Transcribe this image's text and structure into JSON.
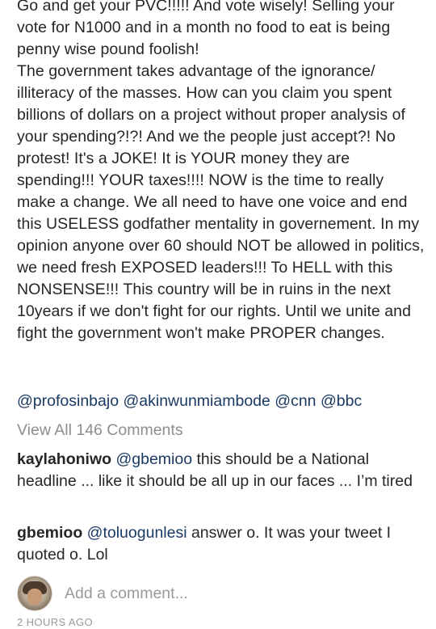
{
  "post": {
    "caption": "Go and get your PVC!!!!! And vote wisely! Selling your vote for N1000 and in a month no food to eat is being penny wise pound foolish!\nThe government takes advantage of the ignorance/ illiteracy of the masses. How can you claim you spent billions of dollars on a project without proper analysis of your spending?!?! And we the people just accept?! No protest! It's a JOKE! It is YOUR money they are spending!!! YOUR taxes!!!! NOW is the time to really make a change. We all need to have one voice and end this USELESS godfather mentality in governement. In my opinion anyone over 60 should NOT be allowed in politics, we need fresh EXPOSED leaders!!! To HELL with this NONSENSE!!! This country will be in ruins in the next 10years if we don't fight for our rights. Until we unite and fight the government won't make PROPER changes.",
    "mentions": [
      "@profosinbajo",
      "@akinwunmiambode",
      "@cnn",
      "@bbc"
    ]
  },
  "comments_link": "View All 146 Comments",
  "comments": [
    {
      "user": "kaylahoniwo",
      "tag": "@gbemioo",
      "text": " this should be a National headline ... like it should be all up in our faces ... I’m tired"
    },
    {
      "user": "gbemioo",
      "tag": "@toluogunlesi",
      "text": " answer o. It was your tweet I quoted o. Lol"
    }
  ],
  "add_comment": {
    "placeholder": "Add a comment..."
  },
  "timestamp": "2 HOURS AGO",
  "colors": {
    "text": "#262626",
    "link": "#1b3a63",
    "muted": "#8e8e8e",
    "background": "#ffffff"
  },
  "icons": {
    "avatar": "user-avatar-photo"
  }
}
